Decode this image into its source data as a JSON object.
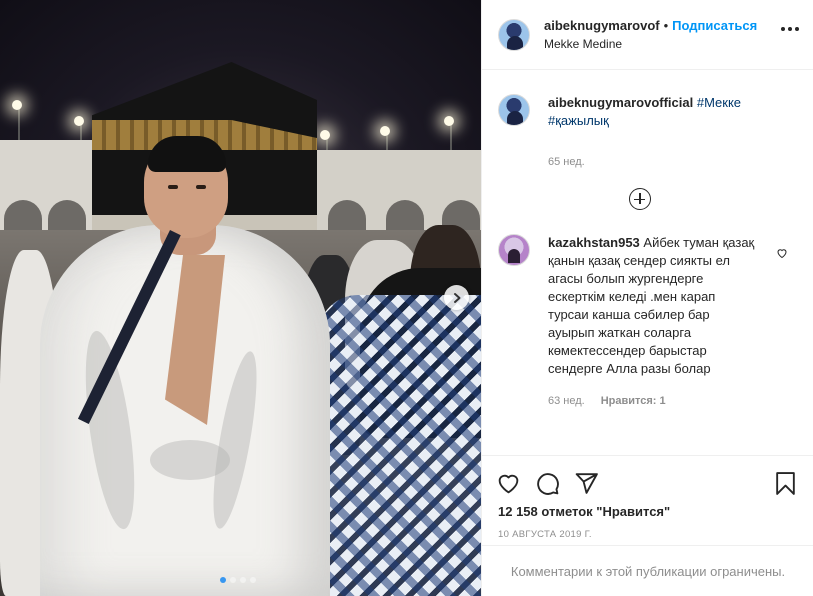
{
  "post": {
    "image_alt": "",
    "carousel": {
      "count": 4,
      "active": 0
    }
  },
  "header": {
    "username": "aibeknugymarovof",
    "separator": "•",
    "follow_label": "Подписаться",
    "location": "Mekke Medine"
  },
  "caption": {
    "username": "aibeknugymarovofficial",
    "tags": [
      "#Мекке",
      "#қажылық"
    ],
    "time": "65 нед."
  },
  "comments": [
    {
      "username": "kazakhstan953",
      "text": "Айбек туман қазақ қанын қазақ сендер сиякты ел агасы болып жургендерге ескерткім келеді .мен карап турсаи канша сәбилер бар ауырып жаткан соларга көмектессендер барыстар сендерге Алла разы болар",
      "time": "63 нед.",
      "likes_label": "Нравится: 1"
    }
  ],
  "actions": {
    "likes_text": "12 158 отметок \"Нравится\"",
    "date": "10 августа 2019 г."
  },
  "comments_restricted": "Комментарии к этой публикации ограничены.",
  "colors": {
    "link": "#0095f6",
    "hashtag": "#00376b",
    "muted": "#8e8e8e",
    "carousel_active": "#3897f0"
  }
}
